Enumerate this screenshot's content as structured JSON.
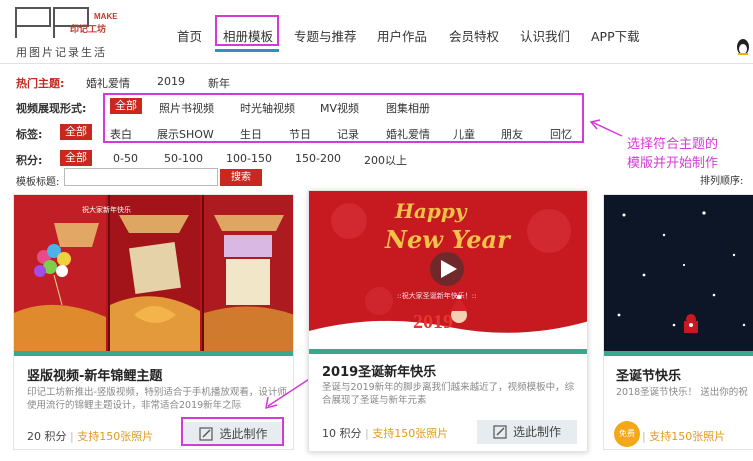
{
  "header": {
    "logo_letters": "PP",
    "logo_make": "MAKE",
    "logo_cn": "印记工坊",
    "logo_tagline": "用图片记录生活",
    "nav": [
      "首页",
      "相册模板",
      "专题与推荐",
      "用户作品",
      "会员特权",
      "认识我们",
      "APP下载"
    ],
    "active_nav": "相册模板"
  },
  "filters": {
    "hot_label": "热门主题:",
    "hot_items": [
      "婚礼爱情",
      "2019",
      "新年"
    ],
    "form_label": "视频展现形式:",
    "form_items": [
      "全部",
      "照片书视频",
      "时光轴视频",
      "MV视频",
      "图集相册"
    ],
    "tag_label": "标签:",
    "tag_items": [
      "全部",
      "表白",
      "展示SHOW",
      "生日",
      "节日",
      "记录",
      "婚礼爱情",
      "儿童",
      "朋友",
      "回忆"
    ],
    "score_label": "积分:",
    "score_items": [
      "全部",
      "0-50",
      "50-100",
      "100-150",
      "150-200",
      "200以上"
    ],
    "template_title_label": "模板标题:",
    "search_value": "",
    "search_button": "搜索",
    "sort_label": "排列顺序:"
  },
  "annotation": {
    "line1": "选择符合主题的",
    "line2": "模版并开始制作"
  },
  "cards": [
    {
      "title": "竖版视频-新年锦鲤主题",
      "desc": "印记工坊新推出-竖版视频，特别适合于手机播放观看，设计师使用流行的锦鲤主题设计，非常适合2019新年之际",
      "points": "20 积分",
      "photos": "支持150张照片",
      "button": "选此制作",
      "thumb_text": "祝大家新年快乐"
    },
    {
      "title": "2019圣诞新年快乐",
      "desc": "圣诞与2019新年的脚步离我们越来越近了，视频模板中，综合展现了圣诞与新年元素",
      "points": "10 积分",
      "photos": "支持150张照片",
      "button": "选此制作",
      "thumb_happy": "Happy",
      "thumb_newyear": "New Year",
      "thumb_sub": "::祝大家圣诞新年快乐！::",
      "thumb_year": "2019"
    },
    {
      "title": "圣诞节快乐",
      "desc": "2018圣诞节快乐！ 送出你的祝",
      "points": "",
      "photos": "支持150张照片",
      "badge": "免费"
    }
  ],
  "colors": {
    "accent_red": "#c8281e",
    "highlight_magenta": "#d63ad6",
    "nav_underline": "#3a8cbf",
    "card_bar": "#3aa88c"
  }
}
